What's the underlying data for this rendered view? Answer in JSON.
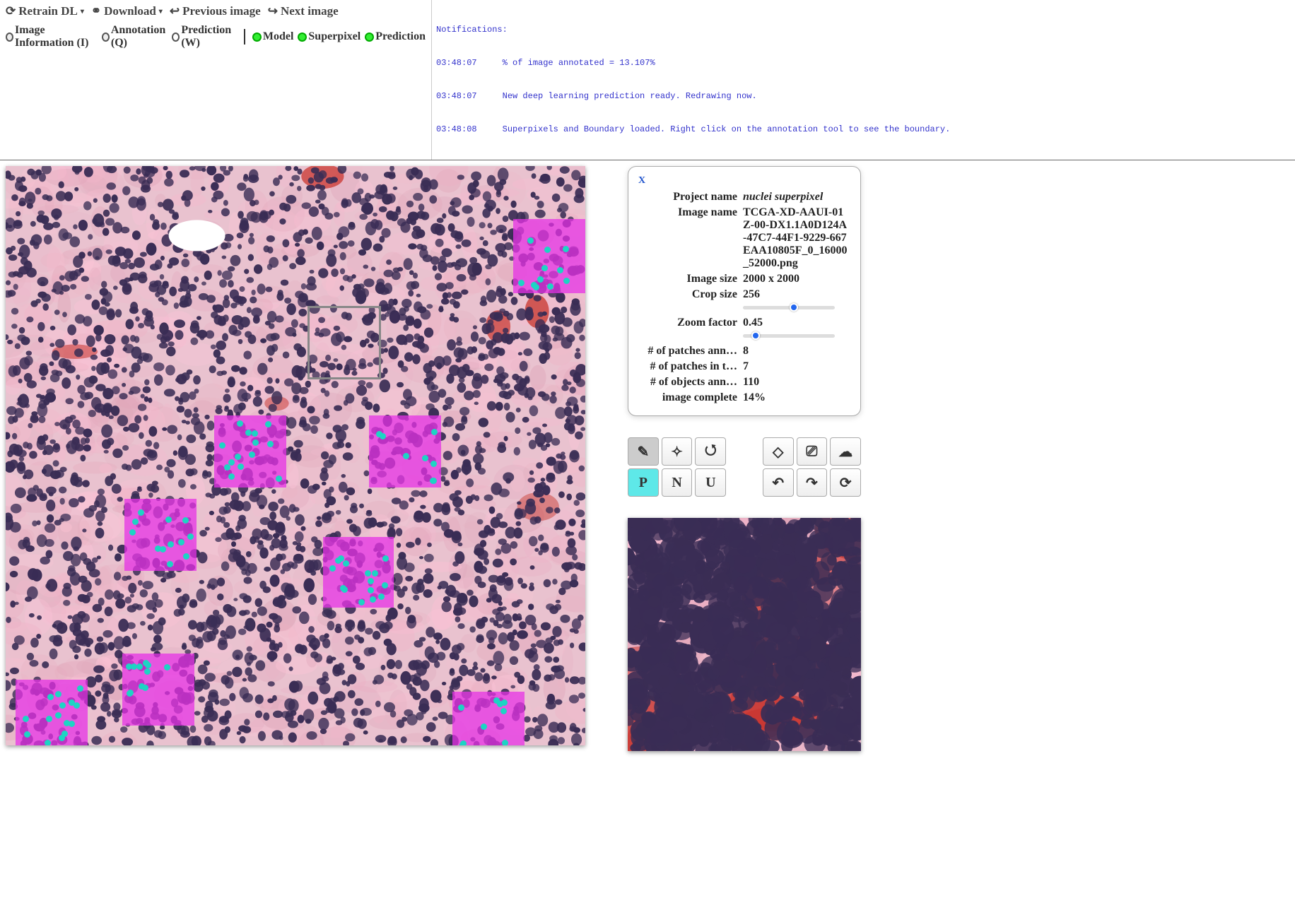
{
  "toolbar": {
    "retrain_dl": "Retrain DL",
    "download": "Download",
    "prev_image": "Previous image",
    "next_image": "Next image"
  },
  "toggles": {
    "image_info": "Image Information (I)",
    "annotation": "Annotation (Q)",
    "prediction_w": "Prediction (W)",
    "model": "Model",
    "superpixel": "Superpixel",
    "prediction": "Prediction"
  },
  "notifications": {
    "header": "Notifications:",
    "lines": [
      {
        "time": "03:48:07",
        "msg": "% of image annotated = 13.107%"
      },
      {
        "time": "03:48:07",
        "msg": "New deep learning prediction ready. Redrawing now."
      },
      {
        "time": "03:48:08",
        "msg": "Superpixels and Boundary loaded. Right click on the annotation tool to see the boundary."
      }
    ]
  },
  "info": {
    "close": "X",
    "labels": {
      "project_name": "Project name",
      "image_name": "Image name",
      "image_size": "Image size",
      "crop_size": "Crop size",
      "zoom_factor": "Zoom factor",
      "patches_ann": "# of patches ann…",
      "patches_int": "# of patches in t…",
      "objects_ann": "# of objects ann…",
      "image_complete": "image complete"
    },
    "values": {
      "project_name": "nuclei superpixel",
      "image_name": "TCGA-XD-AAUI-01Z-00-DX1.1A0D124A-47C7-44F1-9229-667EAA10805F_0_16000_52000.png",
      "image_size": "2000 x 2000",
      "crop_size": "256",
      "zoom_factor": "0.45",
      "patches_ann": "8",
      "patches_int": "7",
      "objects_ann": "110",
      "image_complete": "14%"
    },
    "crop_slider_pct": 51,
    "zoom_slider_pct": 9
  },
  "tools": {
    "p": "P",
    "n": "N",
    "u": "U"
  }
}
